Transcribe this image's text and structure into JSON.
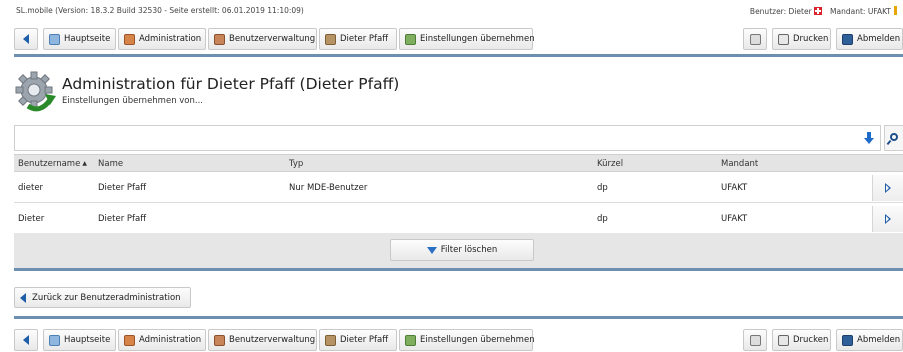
{
  "topline": {
    "app_info": "SL.mobile (Version: 18.3.2 Build 32530 - Seite erstellt: 06.01.2019 11:10:09)",
    "user_label": "Benutzer: Dieter",
    "client_label": "Mandant: UFAKT"
  },
  "toolbar": {
    "home": "Hauptseite",
    "administration": "Administration",
    "user_admin": "Benutzerverwaltung",
    "user": "Dieter Pfaff",
    "apply_settings": "Einstellungen übernehmen",
    "print": "Drucken",
    "logout": "Abmelden"
  },
  "page": {
    "title": "Administration für Dieter Pfaff (Dieter Pfaff)",
    "subtitle": "Einstellungen übernehmen von..."
  },
  "search": {
    "value": "",
    "placeholder": ""
  },
  "table": {
    "headers": [
      "Benutzername",
      "Name",
      "Typ",
      "Kürzel",
      "Mandant"
    ],
    "sort_indicator": "▲",
    "rows": [
      [
        "dieter",
        "Dieter Pfaff",
        "Nur MDE-Benutzer",
        "dp",
        "UFAKT"
      ],
      [
        "Dieter",
        "Dieter Pfaff",
        "",
        "dp",
        "UFAKT"
      ]
    ],
    "filter_clear": "Filter löschen"
  },
  "footer": {
    "back": "Zurück zur Benutzeradministration"
  },
  "colors": {
    "accent_rule": "#6d8fb0",
    "link_blue": "#1f5ea8",
    "flag_red": "#d9232e"
  },
  "icons": {
    "nav_back": "triangle-left-icon",
    "home": "home-icon",
    "administration": "admin-icon",
    "user_admin": "users-icon",
    "user": "user-icon",
    "apply_settings": "settings-apply-icon",
    "glasses": "glasses-icon",
    "print": "printer-icon",
    "logout": "logout-icon",
    "header": "gear-icon",
    "down": "arrow-down-icon",
    "search": "search-icon",
    "row_open": "chevron-right-icon",
    "filter": "filter-icon"
  }
}
